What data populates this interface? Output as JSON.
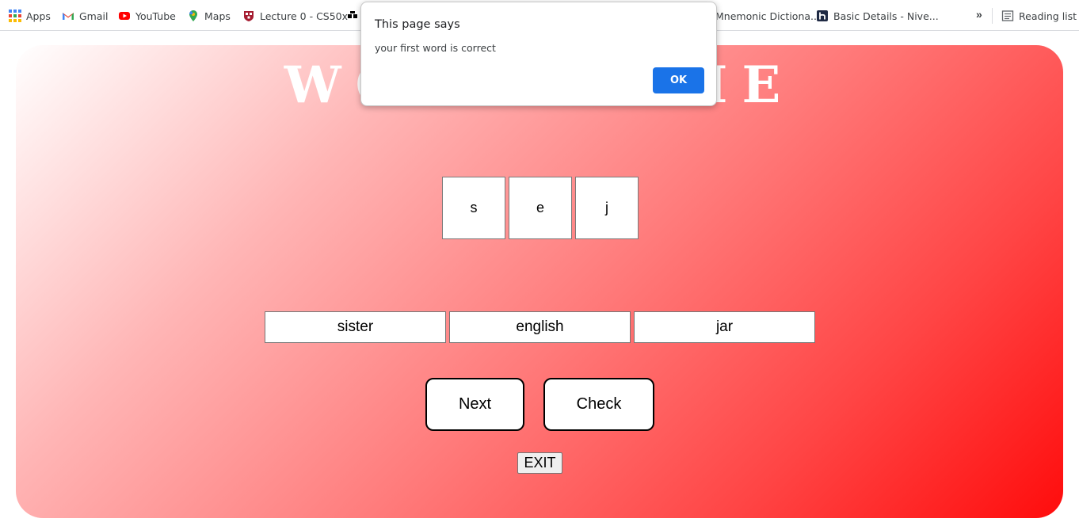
{
  "bookmarks": {
    "items": [
      {
        "label": "Apps",
        "icon": "apps-grid-icon"
      },
      {
        "label": "Gmail",
        "icon": "gmail-icon"
      },
      {
        "label": "YouTube",
        "icon": "youtube-icon"
      },
      {
        "label": "Maps",
        "icon": "maps-pin-icon"
      },
      {
        "label": "Lecture 0 - CS50x",
        "icon": "harvard-shield-icon"
      },
      {
        "label": "Mnemonic Dictiona...",
        "icon": "page-icon"
      },
      {
        "label": "Basic Details - Nive...",
        "icon": "h-logo-icon"
      }
    ],
    "overflow_label": "»",
    "reading_list_label": "Reading list"
  },
  "game": {
    "title": "WORD GAME",
    "tiles": [
      "s",
      "e",
      "j"
    ],
    "answers": [
      "sister",
      "english",
      "jar"
    ],
    "next_label": "Next",
    "check_label": "Check",
    "exit_label": "EXIT",
    "colors": {
      "gradient_start": "#ffffff",
      "gradient_end": "#ff0c0c"
    }
  },
  "dialog": {
    "title": "This page says",
    "message": "your first word is correct",
    "ok_label": "OK",
    "ok_color": "#1a73e8"
  }
}
